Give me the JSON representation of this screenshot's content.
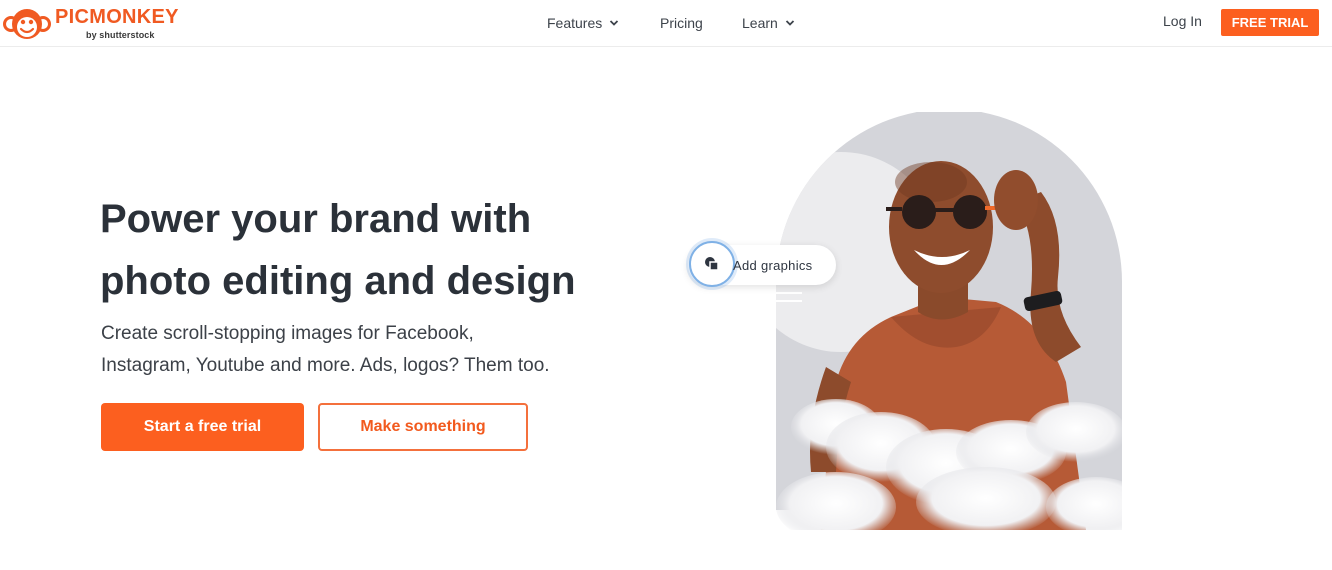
{
  "brand": {
    "name": "PICMONKEY",
    "tagline": "by shutterstock",
    "accent_color": "#fc5f1f"
  },
  "nav": {
    "items": [
      {
        "label": "Features",
        "has_dropdown": true
      },
      {
        "label": "Pricing",
        "has_dropdown": false
      },
      {
        "label": "Learn",
        "has_dropdown": true
      }
    ],
    "login_label": "Log In",
    "trial_label": "FREE TRIAL"
  },
  "hero": {
    "title_line1": "Power your brand with",
    "title_line2": "photo editing and design",
    "subtitle_line1": "Create scroll-stopping images for Facebook,",
    "subtitle_line2": "Instagram, Youtube and more. Ads, logos? Them too.",
    "primary_cta": "Start a free trial",
    "secondary_cta": "Make something",
    "badge_label": "Add graphics"
  },
  "icons": {
    "logo": "monkey-face-icon",
    "dropdown": "chevron-down-icon",
    "graphics": "shapes-icon"
  }
}
